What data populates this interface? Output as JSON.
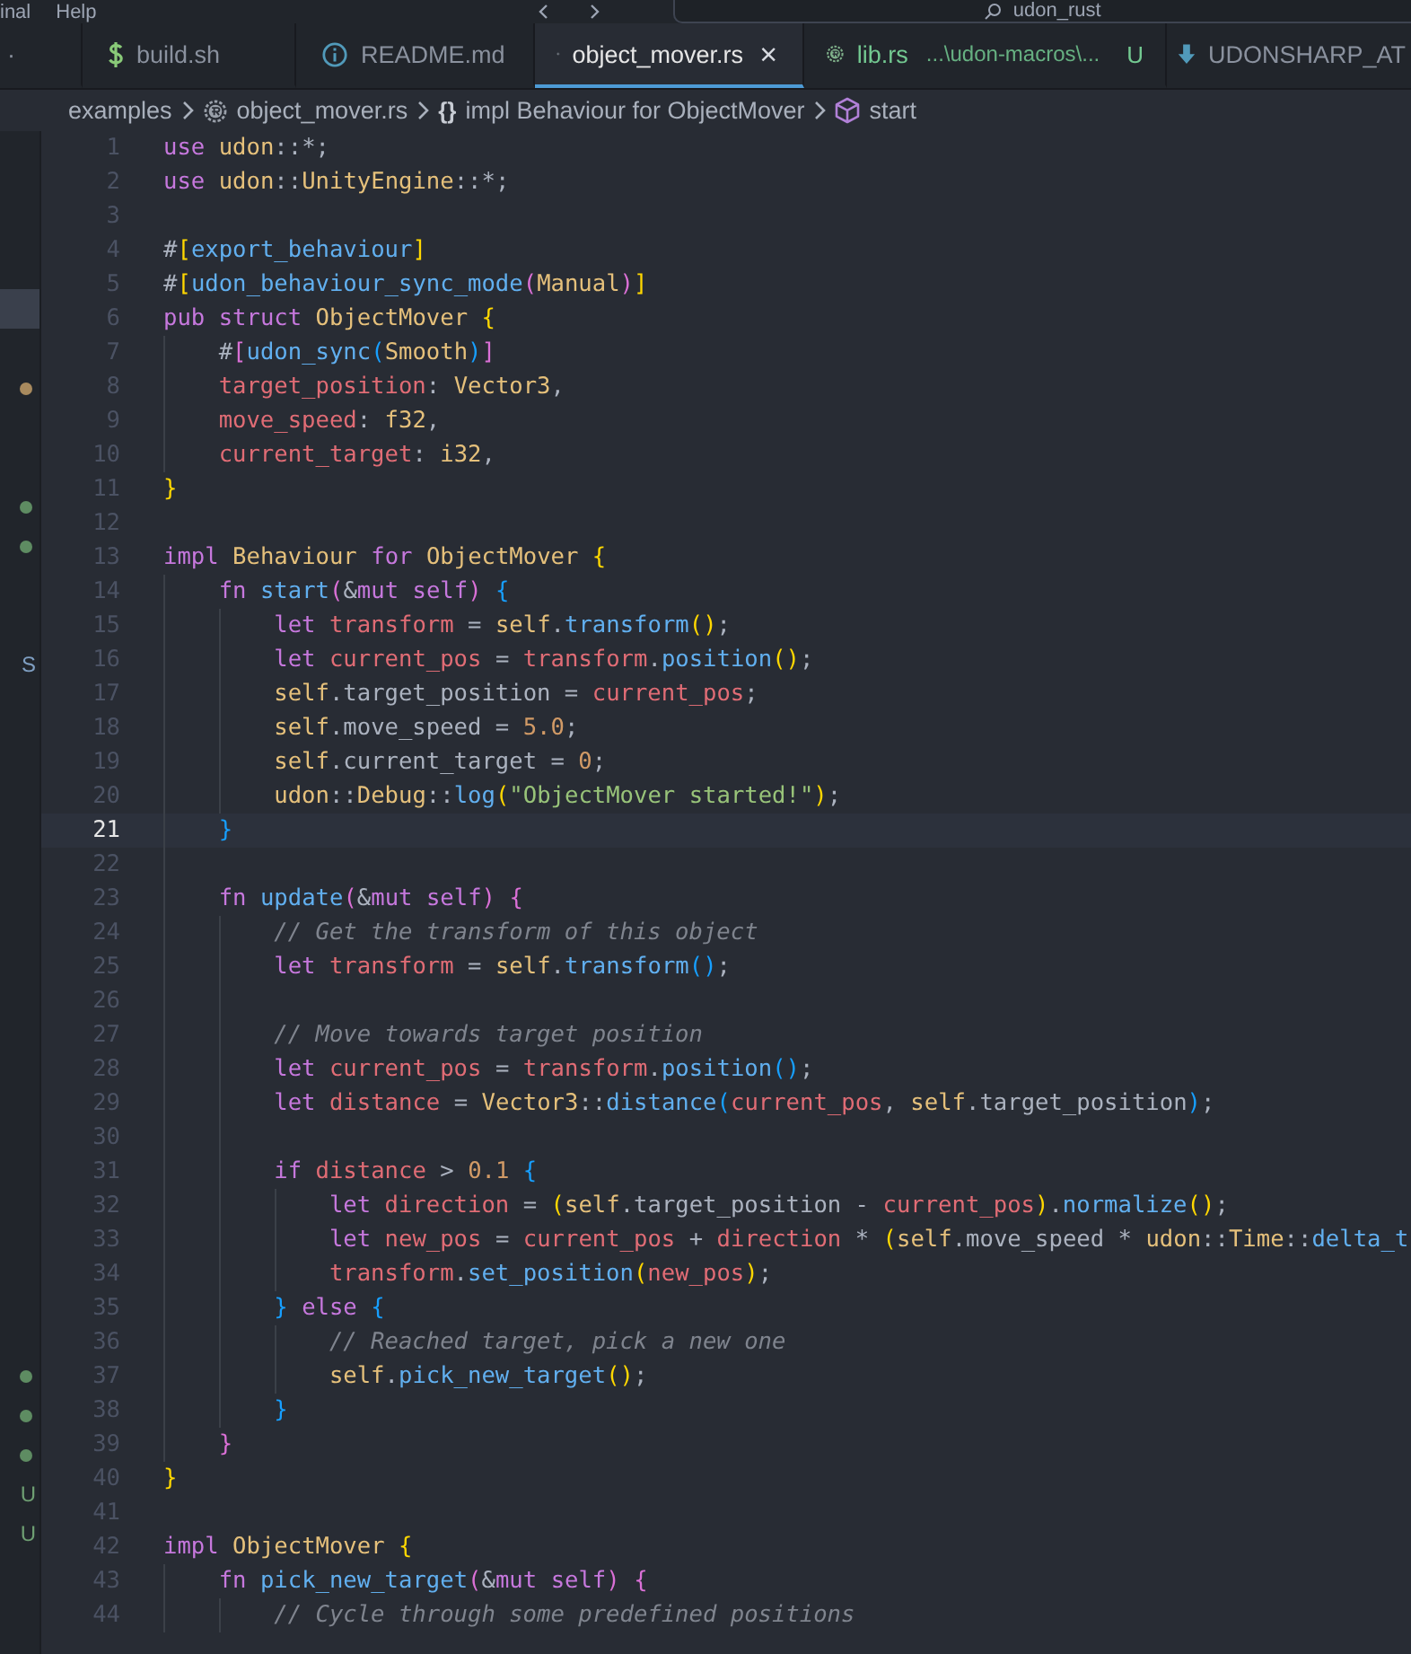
{
  "title_bar": {
    "menu": [
      "inal",
      "Help"
    ],
    "search": {
      "value": "udon_rust"
    }
  },
  "tabs": [
    {
      "kind": "partial",
      "label": "·",
      "selected": false
    },
    {
      "kind": "shell",
      "label": "build.sh",
      "selected": false
    },
    {
      "kind": "info",
      "label": "README.md",
      "selected": false
    },
    {
      "kind": "rust",
      "label": "object_mover.rs",
      "selected": true,
      "close": "×"
    },
    {
      "kind": "rust",
      "label": "lib.rs",
      "selected": false,
      "untracked": true,
      "detail": "...\\udon-macros\\...",
      "badge": "U"
    },
    {
      "kind": "download",
      "label": "UDONSHARP_AT",
      "selected": false
    }
  ],
  "breadcrumb": [
    {
      "kind": "folder",
      "label": "examples"
    },
    {
      "kind": "rust",
      "label": "object_mover.rs"
    },
    {
      "kind": "braces",
      "glyph": "{}",
      "label": "impl Behaviour for ObjectMover"
    },
    {
      "kind": "cube",
      "label": "start"
    }
  ],
  "sidebar": {
    "rows": [
      {
        "kind": "blank",
        "selected": false
      },
      {
        "kind": "blank",
        "selected": false
      },
      {
        "kind": "blank",
        "selected": false
      },
      {
        "kind": "blank",
        "selected": false
      },
      {
        "kind": "blank",
        "selected": true
      },
      {
        "kind": "blank",
        "selected": false
      },
      {
        "kind": "dot",
        "selected": false,
        "color": "#a88a5e"
      },
      {
        "kind": "blank",
        "selected": false
      },
      {
        "kind": "blank",
        "selected": false
      },
      {
        "kind": "dot",
        "selected": false,
        "color": "#5e8c62"
      },
      {
        "kind": "dot",
        "selected": false,
        "color": "#5e8c62"
      },
      {
        "kind": "blank",
        "selected": false
      },
      {
        "kind": "blank",
        "selected": false
      },
      {
        "kind": "letter",
        "selected": false,
        "text": "S",
        "color": "#7f9fc2"
      },
      {
        "kind": "blank",
        "selected": false
      },
      {
        "kind": "blank",
        "selected": false
      },
      {
        "kind": "blank",
        "selected": false
      },
      {
        "kind": "blank",
        "selected": false
      },
      {
        "kind": "blank",
        "selected": false
      },
      {
        "kind": "blank",
        "selected": false
      },
      {
        "kind": "blank",
        "selected": false
      },
      {
        "kind": "blank",
        "selected": false
      },
      {
        "kind": "blank",
        "selected": false
      },
      {
        "kind": "blank",
        "selected": false
      },
      {
        "kind": "blank",
        "selected": false
      },
      {
        "kind": "blank",
        "selected": false
      },
      {
        "kind": "blank",
        "selected": false
      },
      {
        "kind": "blank",
        "selected": false
      },
      {
        "kind": "blank",
        "selected": false
      },
      {
        "kind": "blank",
        "selected": false
      },
      {
        "kind": "blank",
        "selected": false
      },
      {
        "kind": "dot",
        "selected": false,
        "color": "#5e8c62"
      },
      {
        "kind": "dot",
        "selected": false,
        "color": "#5e8c62"
      },
      {
        "kind": "dot",
        "selected": false,
        "color": "#5e8c62"
      },
      {
        "kind": "letter",
        "selected": false,
        "text": "U",
        "color": "#6e9e72"
      },
      {
        "kind": "letter",
        "selected": false,
        "text": "U",
        "color": "#6e9e72"
      }
    ]
  },
  "editor": {
    "lines": [
      {
        "number": "1",
        "current": false,
        "tokens": [
          {
            "kind": "kw",
            "text": "use"
          },
          {
            "kind": "mod",
            "text": "udon",
            "gap": true
          },
          {
            "kind": "p",
            "text": "::*;"
          }
        ]
      },
      {
        "number": "2",
        "current": false,
        "tokens": [
          {
            "kind": "kw",
            "text": "use"
          },
          {
            "kind": "mod",
            "text": "udon",
            "gap": true
          },
          {
            "kind": "p",
            "text": "::"
          },
          {
            "kind": "ty",
            "text": "UnityEngine"
          },
          {
            "kind": "p",
            "text": "::*;"
          }
        ]
      },
      {
        "number": "3",
        "current": false
      },
      {
        "number": "4",
        "current": false,
        "tokens": [
          {
            "kind": "p",
            "text": "#"
          },
          {
            "kind": "b1",
            "text": "["
          },
          {
            "kind": "attr",
            "text": "export_behaviour"
          },
          {
            "kind": "b1",
            "text": "]"
          }
        ]
      },
      {
        "number": "5",
        "current": false,
        "tokens": [
          {
            "kind": "p",
            "text": "#"
          },
          {
            "kind": "b1",
            "text": "["
          },
          {
            "kind": "attr",
            "text": "udon_behaviour_sync_mode"
          },
          {
            "kind": "b2",
            "text": "("
          },
          {
            "kind": "ty",
            "text": "Manual"
          },
          {
            "kind": "b2",
            "text": ")"
          },
          {
            "kind": "b1",
            "text": "]"
          }
        ]
      },
      {
        "number": "6",
        "current": false,
        "tokens": [
          {
            "kind": "kw",
            "text": "pub"
          },
          {
            "kind": "kw",
            "text": "struct",
            "gap": true
          },
          {
            "kind": "ty",
            "text": "ObjectMover",
            "gap": true
          },
          {
            "kind": "b1",
            "text": "{",
            "gap": true
          }
        ],
        "children": [
          {
            "number": "7",
            "current": false,
            "tokens": [
              {
                "kind": "p",
                "text": "#"
              },
              {
                "kind": "b2",
                "text": "["
              },
              {
                "kind": "attr",
                "text": "udon_sync"
              },
              {
                "kind": "b3",
                "text": "("
              },
              {
                "kind": "ty",
                "text": "Smooth"
              },
              {
                "kind": "b3",
                "text": ")"
              },
              {
                "kind": "b2",
                "text": "]"
              }
            ]
          },
          {
            "number": "8",
            "current": false,
            "tokens": [
              {
                "kind": "var",
                "text": "target_position"
              },
              {
                "kind": "p",
                "text": ":"
              },
              {
                "kind": "ty",
                "text": "Vector3",
                "gap": true
              },
              {
                "kind": "p",
                "text": ","
              }
            ]
          },
          {
            "number": "9",
            "current": false,
            "tokens": [
              {
                "kind": "var",
                "text": "move_speed"
              },
              {
                "kind": "p",
                "text": ":"
              },
              {
                "kind": "ty",
                "text": "f32",
                "gap": true
              },
              {
                "kind": "p",
                "text": ","
              }
            ]
          },
          {
            "number": "10",
            "current": false,
            "tokens": [
              {
                "kind": "var",
                "text": "current_target"
              },
              {
                "kind": "p",
                "text": ":"
              },
              {
                "kind": "ty",
                "text": "i32",
                "gap": true
              },
              {
                "kind": "p",
                "text": ","
              }
            ]
          }
        ]
      },
      {
        "number": "11",
        "current": false,
        "tokens": [
          {
            "kind": "b1",
            "text": "}"
          }
        ]
      },
      {
        "number": "12",
        "current": false
      },
      {
        "number": "13",
        "current": false,
        "tokens": [
          {
            "kind": "kw",
            "text": "impl"
          },
          {
            "kind": "ty",
            "text": "Behaviour",
            "gap": true
          },
          {
            "kind": "kw",
            "text": "for",
            "gap": true
          },
          {
            "kind": "ty",
            "text": "ObjectMover",
            "gap": true
          },
          {
            "kind": "b1",
            "text": "{",
            "gap": true
          }
        ],
        "children": [
          {
            "number": "14",
            "current": false,
            "tokens": [
              {
                "kind": "kw",
                "text": "fn"
              },
              {
                "kind": "fn",
                "text": "start",
                "gap": true
              },
              {
                "kind": "b2",
                "text": "("
              },
              {
                "kind": "p",
                "text": "&"
              },
              {
                "kind": "kw",
                "text": "mut"
              },
              {
                "kind": "kw",
                "text": "self",
                "gap": true
              },
              {
                "kind": "b2",
                "text": ")"
              },
              {
                "kind": "b3",
                "text": "{",
                "gap": true
              }
            ],
            "children": [
              {
                "number": "15",
                "current": false,
                "tokens": [
                  {
                    "kind": "kw",
                    "text": "let"
                  },
                  {
                    "kind": "var",
                    "text": "transform",
                    "gap": true
                  },
                  {
                    "kind": "p",
                    "text": "=",
                    "gap": true
                  },
                  {
                    "kind": "self",
                    "text": "self",
                    "gap": true
                  },
                  {
                    "kind": "p",
                    "text": "."
                  },
                  {
                    "kind": "fn",
                    "text": "transform"
                  },
                  {
                    "kind": "b1",
                    "text": "()"
                  },
                  {
                    "kind": "p",
                    "text": ";"
                  }
                ]
              },
              {
                "number": "16",
                "current": false,
                "tokens": [
                  {
                    "kind": "kw",
                    "text": "let"
                  },
                  {
                    "kind": "var",
                    "text": "current_pos",
                    "gap": true
                  },
                  {
                    "kind": "p",
                    "text": "=",
                    "gap": true
                  },
                  {
                    "kind": "var",
                    "text": "transform",
                    "gap": true
                  },
                  {
                    "kind": "p",
                    "text": "."
                  },
                  {
                    "kind": "fn",
                    "text": "position"
                  },
                  {
                    "kind": "b1",
                    "text": "()"
                  },
                  {
                    "kind": "p",
                    "text": ";"
                  }
                ]
              },
              {
                "number": "17",
                "current": false,
                "tokens": [
                  {
                    "kind": "self",
                    "text": "self"
                  },
                  {
                    "kind": "p",
                    "text": ".target_position ="
                  },
                  {
                    "kind": "var",
                    "text": "current_pos",
                    "gap": true
                  },
                  {
                    "kind": "p",
                    "text": ";"
                  }
                ]
              },
              {
                "number": "18",
                "current": false,
                "tokens": [
                  {
                    "kind": "self",
                    "text": "self"
                  },
                  {
                    "kind": "p",
                    "text": ".move_speed ="
                  },
                  {
                    "kind": "num",
                    "text": "5.0",
                    "gap": true
                  },
                  {
                    "kind": "p",
                    "text": ";"
                  }
                ]
              },
              {
                "number": "19",
                "current": false,
                "tokens": [
                  {
                    "kind": "self",
                    "text": "self"
                  },
                  {
                    "kind": "p",
                    "text": ".current_target ="
                  },
                  {
                    "kind": "num",
                    "text": "0",
                    "gap": true
                  },
                  {
                    "kind": "p",
                    "text": ";"
                  }
                ]
              },
              {
                "number": "20",
                "current": false,
                "tokens": [
                  {
                    "kind": "mod",
                    "text": "udon"
                  },
                  {
                    "kind": "p",
                    "text": "::"
                  },
                  {
                    "kind": "ty",
                    "text": "Debug"
                  },
                  {
                    "kind": "p",
                    "text": "::"
                  },
                  {
                    "kind": "fn",
                    "text": "log"
                  },
                  {
                    "kind": "b1",
                    "text": "("
                  },
                  {
                    "kind": "str",
                    "text": "\"ObjectMover started!\""
                  },
                  {
                    "kind": "b1",
                    "text": ")"
                  },
                  {
                    "kind": "p",
                    "text": ";"
                  }
                ]
              }
            ]
          },
          {
            "number": "21",
            "current": true,
            "tokens": [
              {
                "kind": "b3",
                "text": "}"
              }
            ]
          },
          {
            "number": "22",
            "current": false
          },
          {
            "number": "23",
            "current": false,
            "tokens": [
              {
                "kind": "kw",
                "text": "fn"
              },
              {
                "kind": "fn",
                "text": "update",
                "gap": true
              },
              {
                "kind": "b2",
                "text": "("
              },
              {
                "kind": "p",
                "text": "&"
              },
              {
                "kind": "kw",
                "text": "mut"
              },
              {
                "kind": "kw",
                "text": "self",
                "gap": true
              },
              {
                "kind": "b2",
                "text": ")"
              },
              {
                "kind": "b2",
                "text": "{",
                "gap": true
              }
            ],
            "children": [
              {
                "number": "24",
                "current": false,
                "tokens": [
                  {
                    "kind": "com",
                    "text": "// Get the transform of this object"
                  }
                ]
              },
              {
                "number": "25",
                "current": false,
                "tokens": [
                  {
                    "kind": "kw",
                    "text": "let"
                  },
                  {
                    "kind": "var",
                    "text": "transform",
                    "gap": true
                  },
                  {
                    "kind": "p",
                    "text": "=",
                    "gap": true
                  },
                  {
                    "kind": "self",
                    "text": "self",
                    "gap": true
                  },
                  {
                    "kind": "p",
                    "text": "."
                  },
                  {
                    "kind": "fn",
                    "text": "transform"
                  },
                  {
                    "kind": "b3",
                    "text": "()"
                  },
                  {
                    "kind": "p",
                    "text": ";"
                  }
                ]
              },
              {
                "number": "26",
                "current": false
              },
              {
                "number": "27",
                "current": false,
                "tokens": [
                  {
                    "kind": "com",
                    "text": "// Move towards target position"
                  }
                ]
              },
              {
                "number": "28",
                "current": false,
                "tokens": [
                  {
                    "kind": "kw",
                    "text": "let"
                  },
                  {
                    "kind": "var",
                    "text": "current_pos",
                    "gap": true
                  },
                  {
                    "kind": "p",
                    "text": "=",
                    "gap": true
                  },
                  {
                    "kind": "var",
                    "text": "transform",
                    "gap": true
                  },
                  {
                    "kind": "p",
                    "text": "."
                  },
                  {
                    "kind": "fn",
                    "text": "position"
                  },
                  {
                    "kind": "b3",
                    "text": "()"
                  },
                  {
                    "kind": "p",
                    "text": ";"
                  }
                ]
              },
              {
                "number": "29",
                "current": false,
                "tokens": [
                  {
                    "kind": "kw",
                    "text": "let"
                  },
                  {
                    "kind": "var",
                    "text": "distance",
                    "gap": true
                  },
                  {
                    "kind": "p",
                    "text": "=",
                    "gap": true
                  },
                  {
                    "kind": "ty",
                    "text": "Vector3",
                    "gap": true
                  },
                  {
                    "kind": "p",
                    "text": "::"
                  },
                  {
                    "kind": "fn",
                    "text": "distance"
                  },
                  {
                    "kind": "b3",
                    "text": "("
                  },
                  {
                    "kind": "var",
                    "text": "current_pos"
                  },
                  {
                    "kind": "p",
                    "text": ","
                  },
                  {
                    "kind": "self",
                    "text": "self",
                    "gap": true
                  },
                  {
                    "kind": "p",
                    "text": ".target_position"
                  },
                  {
                    "kind": "b3",
                    "text": ")"
                  },
                  {
                    "kind": "p",
                    "text": ";"
                  }
                ]
              },
              {
                "number": "30",
                "current": false
              },
              {
                "number": "31",
                "current": false,
                "tokens": [
                  {
                    "kind": "kw",
                    "text": "if"
                  },
                  {
                    "kind": "var",
                    "text": "distance",
                    "gap": true
                  },
                  {
                    "kind": "p",
                    "text": ">",
                    "gap": true
                  },
                  {
                    "kind": "num",
                    "text": "0.1",
                    "gap": true
                  },
                  {
                    "kind": "b3",
                    "text": "{",
                    "gap": true
                  }
                ],
                "children": [
                  {
                    "number": "32",
                    "current": false,
                    "tokens": [
                      {
                        "kind": "kw",
                        "text": "let"
                      },
                      {
                        "kind": "var",
                        "text": "direction",
                        "gap": true
                      },
                      {
                        "kind": "p",
                        "text": "=",
                        "gap": true
                      },
                      {
                        "kind": "b1",
                        "text": "(",
                        "gap": true
                      },
                      {
                        "kind": "self",
                        "text": "self"
                      },
                      {
                        "kind": "p",
                        "text": ".target_position -"
                      },
                      {
                        "kind": "var",
                        "text": "current_pos",
                        "gap": true
                      },
                      {
                        "kind": "b1",
                        "text": ")"
                      },
                      {
                        "kind": "p",
                        "text": "."
                      },
                      {
                        "kind": "fn",
                        "text": "normalize"
                      },
                      {
                        "kind": "b1",
                        "text": "()"
                      },
                      {
                        "kind": "p",
                        "text": ";"
                      }
                    ]
                  },
                  {
                    "number": "33",
                    "current": false,
                    "tokens": [
                      {
                        "kind": "kw",
                        "text": "let"
                      },
                      {
                        "kind": "var",
                        "text": "new_pos",
                        "gap": true
                      },
                      {
                        "kind": "p",
                        "text": "=",
                        "gap": true
                      },
                      {
                        "kind": "var",
                        "text": "current_pos",
                        "gap": true
                      },
                      {
                        "kind": "p",
                        "text": "+",
                        "gap": true
                      },
                      {
                        "kind": "var",
                        "text": "direction",
                        "gap": true
                      },
                      {
                        "kind": "p",
                        "text": "*",
                        "gap": true
                      },
                      {
                        "kind": "b1",
                        "text": "(",
                        "gap": true
                      },
                      {
                        "kind": "self",
                        "text": "self"
                      },
                      {
                        "kind": "p",
                        "text": ".move_speed *"
                      },
                      {
                        "kind": "mod",
                        "text": "udon",
                        "gap": true
                      },
                      {
                        "kind": "p",
                        "text": "::"
                      },
                      {
                        "kind": "ty",
                        "text": "Time"
                      },
                      {
                        "kind": "p",
                        "text": "::"
                      },
                      {
                        "kind": "fn",
                        "text": "delta_t"
                      }
                    ]
                  },
                  {
                    "number": "34",
                    "current": false,
                    "tokens": [
                      {
                        "kind": "var",
                        "text": "transform"
                      },
                      {
                        "kind": "p",
                        "text": "."
                      },
                      {
                        "kind": "fn",
                        "text": "set_position"
                      },
                      {
                        "kind": "b1",
                        "text": "("
                      },
                      {
                        "kind": "var",
                        "text": "new_pos"
                      },
                      {
                        "kind": "b1",
                        "text": ")"
                      },
                      {
                        "kind": "p",
                        "text": ";"
                      }
                    ]
                  }
                ]
              },
              {
                "number": "35",
                "current": false,
                "tokens": [
                  {
                    "kind": "b3",
                    "text": "}"
                  },
                  {
                    "kind": "kw",
                    "text": "else",
                    "gap": true
                  },
                  {
                    "kind": "b3",
                    "text": "{",
                    "gap": true
                  }
                ],
                "children": [
                  {
                    "number": "36",
                    "current": false,
                    "tokens": [
                      {
                        "kind": "com",
                        "text": "// Reached target, pick a new one"
                      }
                    ]
                  },
                  {
                    "number": "37",
                    "current": false,
                    "tokens": [
                      {
                        "kind": "self",
                        "text": "self"
                      },
                      {
                        "kind": "p",
                        "text": "."
                      },
                      {
                        "kind": "fn",
                        "text": "pick_new_target"
                      },
                      {
                        "kind": "b1",
                        "text": "()"
                      },
                      {
                        "kind": "p",
                        "text": ";"
                      }
                    ]
                  }
                ]
              },
              {
                "number": "38",
                "current": false,
                "tokens": [
                  {
                    "kind": "b3",
                    "text": "}"
                  }
                ]
              }
            ]
          },
          {
            "number": "39",
            "current": false,
            "tokens": [
              {
                "kind": "b2",
                "text": "}"
              }
            ]
          }
        ]
      },
      {
        "number": "40",
        "current": false,
        "tokens": [
          {
            "kind": "b1",
            "text": "}"
          }
        ]
      },
      {
        "number": "41",
        "current": false
      },
      {
        "number": "42",
        "current": false,
        "tokens": [
          {
            "kind": "kw",
            "text": "impl"
          },
          {
            "kind": "ty",
            "text": "ObjectMover",
            "gap": true
          },
          {
            "kind": "b1",
            "text": "{",
            "gap": true
          }
        ],
        "children": [
          {
            "number": "43",
            "current": false,
            "tokens": [
              {
                "kind": "kw",
                "text": "fn"
              },
              {
                "kind": "fn",
                "text": "pick_new_target",
                "gap": true
              },
              {
                "kind": "b2",
                "text": "("
              },
              {
                "kind": "p",
                "text": "&"
              },
              {
                "kind": "kw",
                "text": "mut"
              },
              {
                "kind": "kw",
                "text": "self",
                "gap": true
              },
              {
                "kind": "b2",
                "text": ")"
              },
              {
                "kind": "b2",
                "text": "{",
                "gap": true
              }
            ],
            "children": [
              {
                "number": "44",
                "current": false,
                "tokens": [
                  {
                    "kind": "com",
                    "text": "// Cycle through some predefined positions"
                  }
                ]
              }
            ]
          }
        ]
      }
    ]
  }
}
